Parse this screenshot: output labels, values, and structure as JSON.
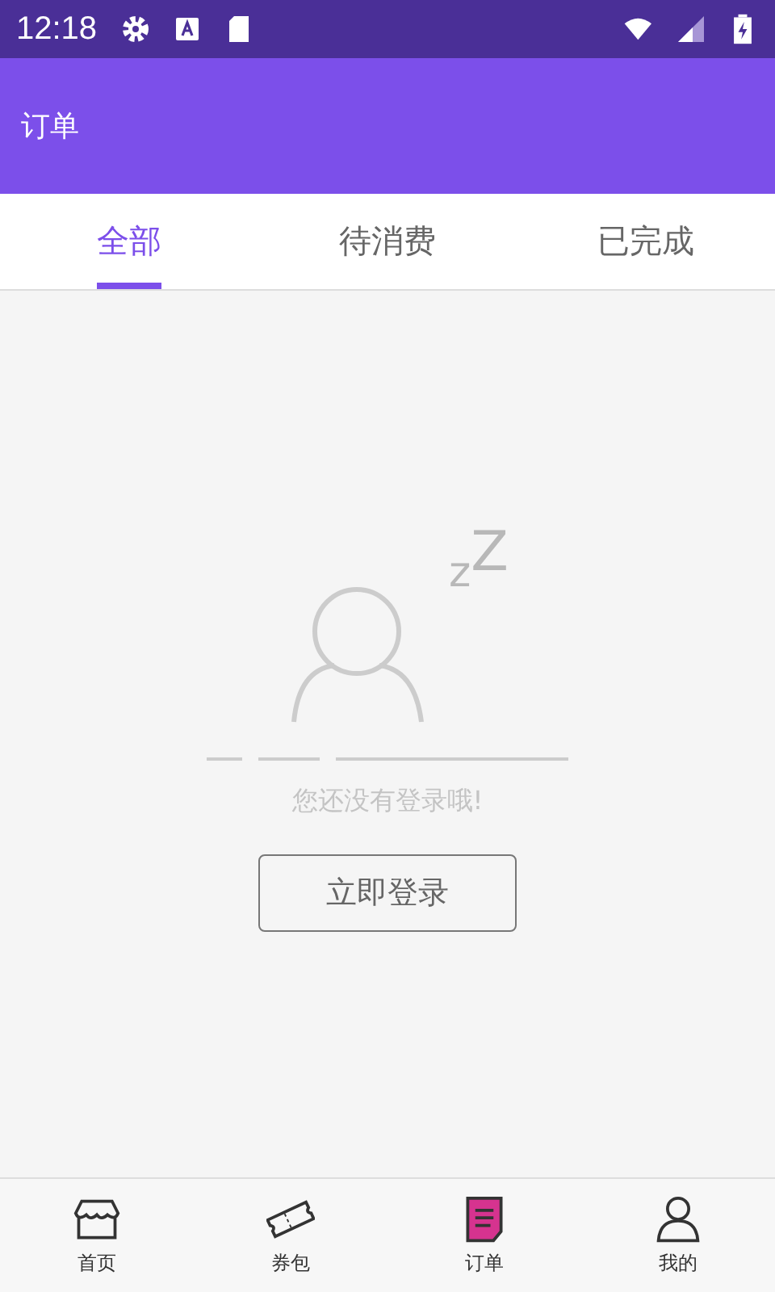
{
  "status_bar": {
    "time": "12:18"
  },
  "app_bar": {
    "title": "订单"
  },
  "tabs": [
    {
      "label": "全部",
      "selected": true
    },
    {
      "label": "待消费",
      "selected": false
    },
    {
      "label": "已完成",
      "selected": false
    }
  ],
  "empty_state": {
    "zz": "zZ",
    "message": "您还没有登录哦!",
    "button": "立即登录"
  },
  "bottom_nav": [
    {
      "kind": "shop",
      "label": "首页",
      "selected": false
    },
    {
      "kind": "ticket",
      "label": "券包",
      "selected": false
    },
    {
      "kind": "order",
      "label": "订单",
      "selected": true
    },
    {
      "kind": "person",
      "label": "我的",
      "selected": false
    }
  ]
}
